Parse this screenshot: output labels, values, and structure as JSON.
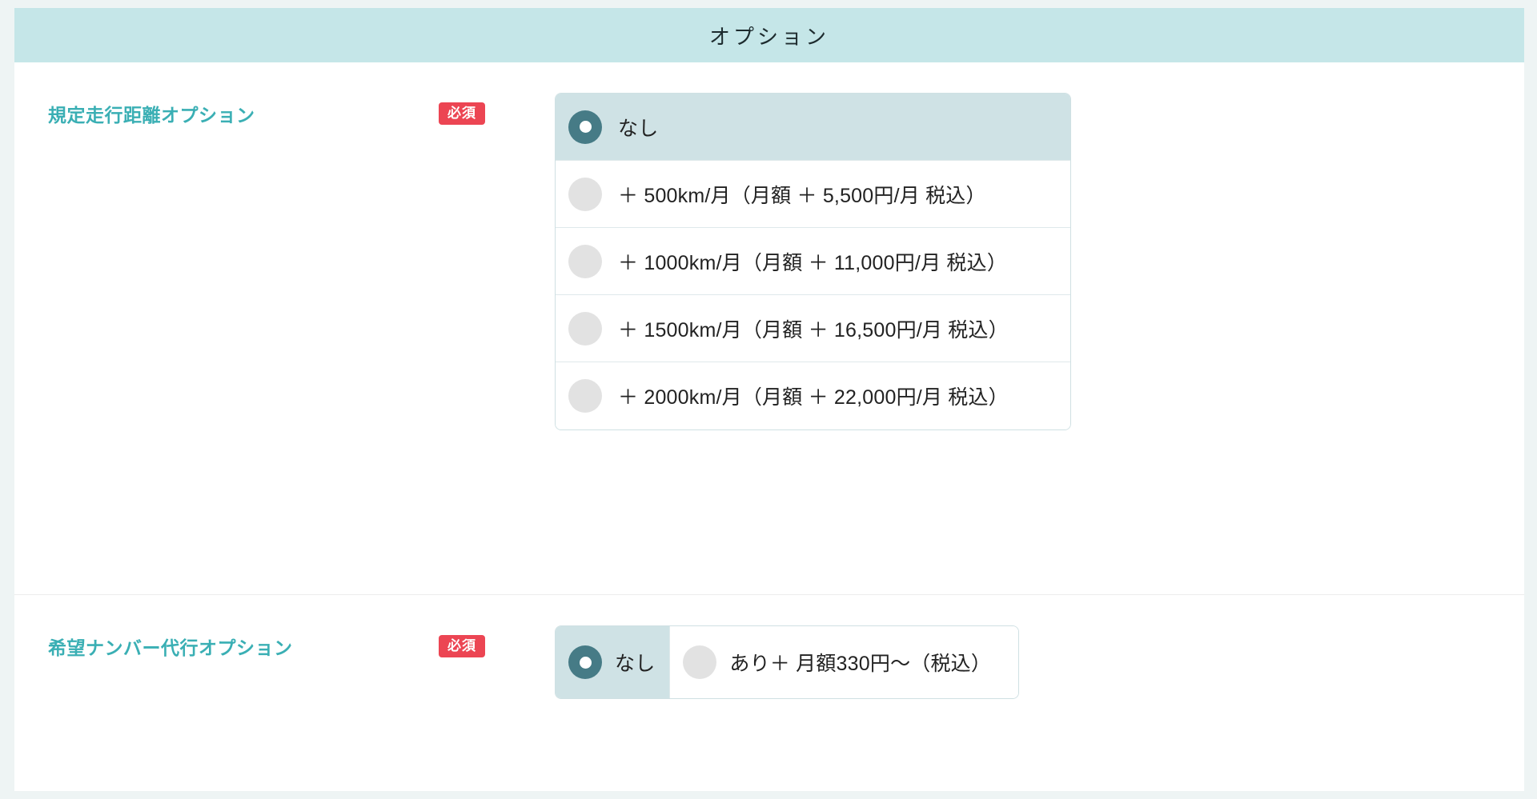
{
  "section": {
    "title": "オプション"
  },
  "badges": {
    "required": "必須"
  },
  "groups": [
    {
      "label": "規定走行距離オプション",
      "required_label": "必須",
      "layout": "vertical",
      "options": [
        {
          "label": "なし",
          "selected": true
        },
        {
          "label": "＋ 500km/月（月額 ＋ 5,500円/月 税込）",
          "selected": false
        },
        {
          "label": "＋ 1000km/月（月額 ＋ 11,000円/月 税込）",
          "selected": false
        },
        {
          "label": "＋ 1500km/月（月額 ＋ 16,500円/月 税込）",
          "selected": false
        },
        {
          "label": "＋ 2000km/月（月額 ＋ 22,000円/月 税込）",
          "selected": false
        }
      ]
    },
    {
      "label": "希望ナンバー代行オプション",
      "required_label": "必須",
      "layout": "horizontal",
      "options": [
        {
          "label": "なし",
          "selected": true
        },
        {
          "label": "あり＋ 月額330円〜（税込）",
          "selected": false
        }
      ]
    }
  ],
  "colors": {
    "page_background": "#eef4f4",
    "card_background": "#ffffff",
    "header_background": "#c5e6e8",
    "label_accent": "#3aafb4",
    "required_badge": "#ec4553",
    "selected_row_background": "#cfe2e5",
    "selected_radio": "#467b86",
    "unselected_radio": "#e2e2e2",
    "border": "#cfe0e3"
  }
}
